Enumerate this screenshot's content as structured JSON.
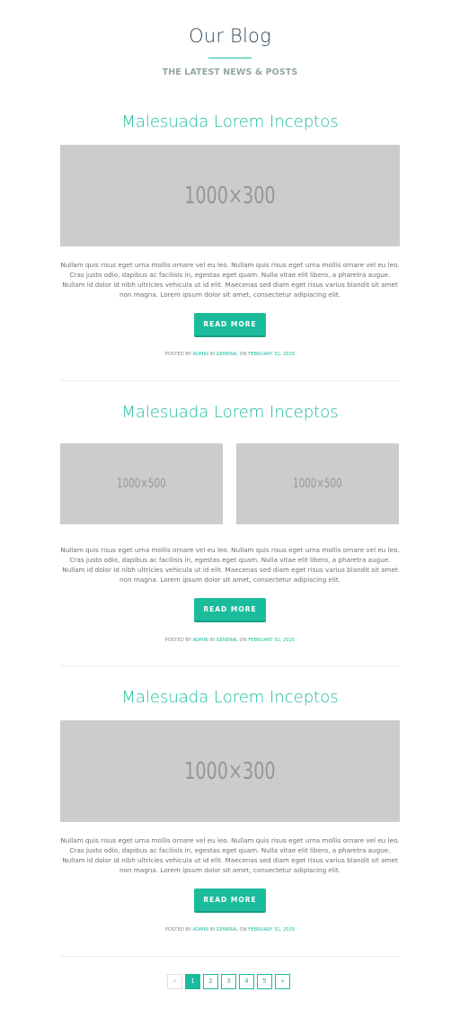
{
  "header": {
    "title": "Our Blog",
    "subtitle": "THE LATEST NEWS & POSTS"
  },
  "colors": {
    "accent": "#1abc9c",
    "accent_dark": "#16a085",
    "heading": "#34495e",
    "placeholder_bg": "#cccccc"
  },
  "posts": [
    {
      "title": "Malesuada Lorem Inceptos",
      "images": [
        "1000×300"
      ],
      "excerpt": "Nullam quis risus eget urna mollis ornare vel eu leo. Nullam quis risus eget urna mollis ornare vel eu leo. Cras justo odio, dapibus ac facilisis in, egestas eget quam. Nulla vitae elit libero, a pharetra augue. Nullam id dolor id nibh ultricies vehicula ut id elit. Maecenas sed diam eget risus varius blandit sit amet non magna. Lorem ipsum dolor sit amet, consectetur adipiscing elit.",
      "button": "READ MORE",
      "meta": {
        "posted_by": "POSTED BY",
        "author": "ADMIN",
        "in": "IN",
        "category": "GENERAL",
        "on": "ON",
        "date": "FEBRUARY 31, 2025"
      }
    },
    {
      "title": "Malesuada Lorem Inceptos",
      "images": [
        "1000×500",
        "1000×500"
      ],
      "excerpt": "Nullam quis risus eget urna mollis ornare vel eu leo. Nullam quis risus eget urna mollis ornare vel eu leo. Cras justo odio, dapibus ac facilisis in, egestas eget quam. Nulla vitae elit libero, a pharetra augue. Nullam id dolor id nibh ultricies vehicula ut id elit. Maecenas sed diam eget risus varius blandit sit amet non magna. Lorem ipsum dolor sit amet, consectetur adipiscing elit.",
      "button": "READ MORE",
      "meta": {
        "posted_by": "POSTED BY",
        "author": "ADMIN",
        "in": "IN",
        "category": "GENERAL",
        "on": "ON",
        "date": "FEBRUARY 31, 2025"
      }
    },
    {
      "title": "Malesuada Lorem Inceptos",
      "images": [
        "1000×300"
      ],
      "excerpt": "Nullam quis risus eget urna mollis ornare vel eu leo. Nullam quis risus eget urna mollis ornare vel eu leo. Cras justo odio, dapibus ac facilisis in, egestas eget quam. Nulla vitae elit libero, a pharetra augue. Nullam id dolor id nibh ultricies vehicula ut id elit. Maecenas sed diam eget risus varius blandit sit amet non magna. Lorem ipsum dolor sit amet, consectetur adipiscing elit.",
      "button": "READ MORE",
      "meta": {
        "posted_by": "POSTED BY",
        "author": "ADMIN",
        "in": "IN",
        "category": "GENERAL",
        "on": "ON",
        "date": "FEBRUARY 31, 2025"
      }
    }
  ],
  "pagination": {
    "prev": "«",
    "pages": [
      "1",
      "2",
      "3",
      "4",
      "5"
    ],
    "current": "1",
    "next": "»"
  }
}
